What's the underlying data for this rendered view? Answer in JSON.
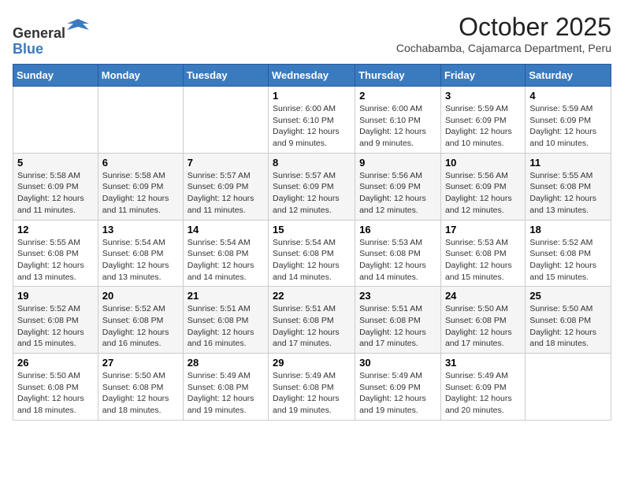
{
  "logo": {
    "text_general": "General",
    "text_blue": "Blue"
  },
  "title": "October 2025",
  "subtitle": "Cochabamba, Cajamarca Department, Peru",
  "weekdays": [
    "Sunday",
    "Monday",
    "Tuesday",
    "Wednesday",
    "Thursday",
    "Friday",
    "Saturday"
  ],
  "weeks": [
    [
      {
        "day": "",
        "info": ""
      },
      {
        "day": "",
        "info": ""
      },
      {
        "day": "",
        "info": ""
      },
      {
        "day": "1",
        "info": "Sunrise: 6:00 AM\nSunset: 6:10 PM\nDaylight: 12 hours and 9 minutes."
      },
      {
        "day": "2",
        "info": "Sunrise: 6:00 AM\nSunset: 6:10 PM\nDaylight: 12 hours and 9 minutes."
      },
      {
        "day": "3",
        "info": "Sunrise: 5:59 AM\nSunset: 6:09 PM\nDaylight: 12 hours and 10 minutes."
      },
      {
        "day": "4",
        "info": "Sunrise: 5:59 AM\nSunset: 6:09 PM\nDaylight: 12 hours and 10 minutes."
      }
    ],
    [
      {
        "day": "5",
        "info": "Sunrise: 5:58 AM\nSunset: 6:09 PM\nDaylight: 12 hours and 11 minutes."
      },
      {
        "day": "6",
        "info": "Sunrise: 5:58 AM\nSunset: 6:09 PM\nDaylight: 12 hours and 11 minutes."
      },
      {
        "day": "7",
        "info": "Sunrise: 5:57 AM\nSunset: 6:09 PM\nDaylight: 12 hours and 11 minutes."
      },
      {
        "day": "8",
        "info": "Sunrise: 5:57 AM\nSunset: 6:09 PM\nDaylight: 12 hours and 12 minutes."
      },
      {
        "day": "9",
        "info": "Sunrise: 5:56 AM\nSunset: 6:09 PM\nDaylight: 12 hours and 12 minutes."
      },
      {
        "day": "10",
        "info": "Sunrise: 5:56 AM\nSunset: 6:09 PM\nDaylight: 12 hours and 12 minutes."
      },
      {
        "day": "11",
        "info": "Sunrise: 5:55 AM\nSunset: 6:08 PM\nDaylight: 12 hours and 13 minutes."
      }
    ],
    [
      {
        "day": "12",
        "info": "Sunrise: 5:55 AM\nSunset: 6:08 PM\nDaylight: 12 hours and 13 minutes."
      },
      {
        "day": "13",
        "info": "Sunrise: 5:54 AM\nSunset: 6:08 PM\nDaylight: 12 hours and 13 minutes."
      },
      {
        "day": "14",
        "info": "Sunrise: 5:54 AM\nSunset: 6:08 PM\nDaylight: 12 hours and 14 minutes."
      },
      {
        "day": "15",
        "info": "Sunrise: 5:54 AM\nSunset: 6:08 PM\nDaylight: 12 hours and 14 minutes."
      },
      {
        "day": "16",
        "info": "Sunrise: 5:53 AM\nSunset: 6:08 PM\nDaylight: 12 hours and 14 minutes."
      },
      {
        "day": "17",
        "info": "Sunrise: 5:53 AM\nSunset: 6:08 PM\nDaylight: 12 hours and 15 minutes."
      },
      {
        "day": "18",
        "info": "Sunrise: 5:52 AM\nSunset: 6:08 PM\nDaylight: 12 hours and 15 minutes."
      }
    ],
    [
      {
        "day": "19",
        "info": "Sunrise: 5:52 AM\nSunset: 6:08 PM\nDaylight: 12 hours and 15 minutes."
      },
      {
        "day": "20",
        "info": "Sunrise: 5:52 AM\nSunset: 6:08 PM\nDaylight: 12 hours and 16 minutes."
      },
      {
        "day": "21",
        "info": "Sunrise: 5:51 AM\nSunset: 6:08 PM\nDaylight: 12 hours and 16 minutes."
      },
      {
        "day": "22",
        "info": "Sunrise: 5:51 AM\nSunset: 6:08 PM\nDaylight: 12 hours and 17 minutes."
      },
      {
        "day": "23",
        "info": "Sunrise: 5:51 AM\nSunset: 6:08 PM\nDaylight: 12 hours and 17 minutes."
      },
      {
        "day": "24",
        "info": "Sunrise: 5:50 AM\nSunset: 6:08 PM\nDaylight: 12 hours and 17 minutes."
      },
      {
        "day": "25",
        "info": "Sunrise: 5:50 AM\nSunset: 6:08 PM\nDaylight: 12 hours and 18 minutes."
      }
    ],
    [
      {
        "day": "26",
        "info": "Sunrise: 5:50 AM\nSunset: 6:08 PM\nDaylight: 12 hours and 18 minutes."
      },
      {
        "day": "27",
        "info": "Sunrise: 5:50 AM\nSunset: 6:08 PM\nDaylight: 12 hours and 18 minutes."
      },
      {
        "day": "28",
        "info": "Sunrise: 5:49 AM\nSunset: 6:08 PM\nDaylight: 12 hours and 19 minutes."
      },
      {
        "day": "29",
        "info": "Sunrise: 5:49 AM\nSunset: 6:08 PM\nDaylight: 12 hours and 19 minutes."
      },
      {
        "day": "30",
        "info": "Sunrise: 5:49 AM\nSunset: 6:09 PM\nDaylight: 12 hours and 19 minutes."
      },
      {
        "day": "31",
        "info": "Sunrise: 5:49 AM\nSunset: 6:09 PM\nDaylight: 12 hours and 20 minutes."
      },
      {
        "day": "",
        "info": ""
      }
    ]
  ]
}
